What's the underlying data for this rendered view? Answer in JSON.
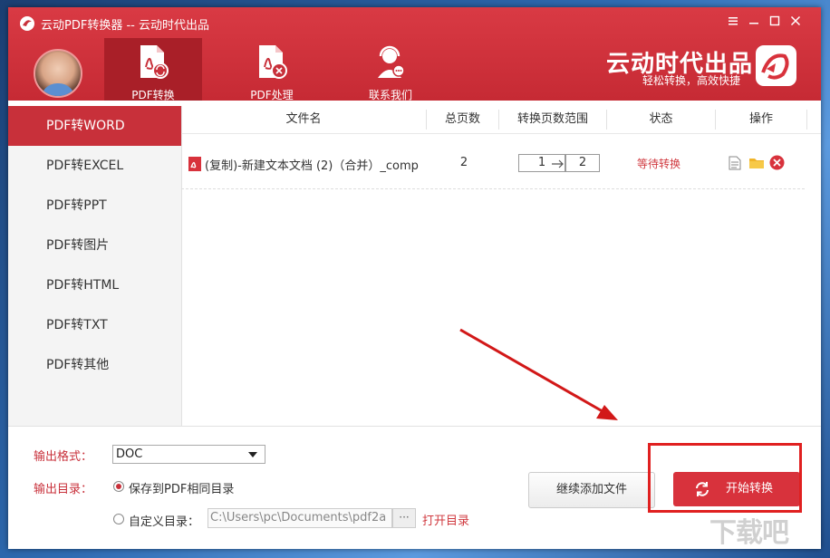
{
  "window": {
    "title": "云动PDF转换器 -- 云动时代出品",
    "controls": [
      "settings-icon",
      "minimize-icon",
      "maximize-icon",
      "close-icon"
    ]
  },
  "header": {
    "tabs": [
      {
        "label": "PDF转换",
        "icon": "pdf-convert-icon",
        "active": true
      },
      {
        "label": "PDF处理",
        "icon": "pdf-process-icon",
        "active": false
      },
      {
        "label": "联系我们",
        "icon": "customer-service-icon",
        "active": false
      }
    ],
    "brand_name": "云动时代出品",
    "brand_slogan": "轻松转换，高效快捷"
  },
  "sidebar": {
    "items": [
      {
        "label": "PDF转WORD",
        "active": true
      },
      {
        "label": "PDF转EXCEL",
        "active": false
      },
      {
        "label": "PDF转PPT",
        "active": false
      },
      {
        "label": "PDF转图片",
        "active": false
      },
      {
        "label": "PDF转HTML",
        "active": false
      },
      {
        "label": "PDF转TXT",
        "active": false
      },
      {
        "label": "PDF转其他",
        "active": false
      }
    ]
  },
  "table": {
    "columns": [
      "文件名",
      "总页数",
      "转换页数范围",
      "状态",
      "操作"
    ],
    "rows": [
      {
        "file_name": "(复制)-新建文本文档 (2)（合并）_comp",
        "total_pages": "2",
        "range_from": "1",
        "range_to": "2",
        "status": "等待转换",
        "actions": [
          "file-icon",
          "folder-icon",
          "delete-icon"
        ]
      }
    ]
  },
  "bottom": {
    "output_format_label": "输出格式：",
    "output_format_value": "DOC",
    "output_dir_label": "输出目录：",
    "option_same_dir": "保存到PDF相同目录",
    "option_custom_dir": "自定义目录：",
    "custom_dir_path": "C:\\Users\\pc\\Documents\\pdf2a",
    "browse_label": "···",
    "open_dir_link": "打开目录",
    "add_files_button": "继续添加文件",
    "start_button": "开始转换"
  },
  "colors": {
    "brand_red": "#c8303a",
    "header_red": "#d93a44",
    "status_red": "#d0393f",
    "annotation_red": "#e02020"
  }
}
